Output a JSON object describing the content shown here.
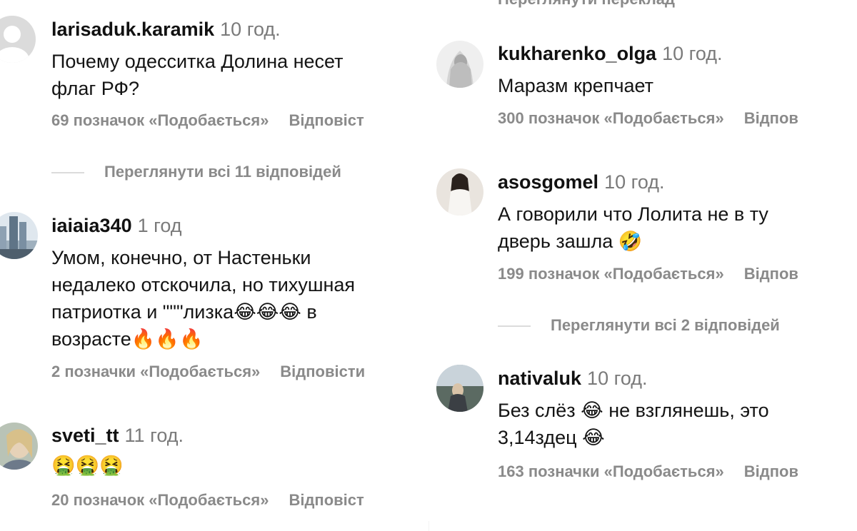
{
  "left": [
    {
      "username": "larisaduk.karamik",
      "time": "10 год.",
      "lines": [
        "Почему одесситка Долина несет",
        "флаг РФ?"
      ],
      "likes": "69 позначок «Подобається»",
      "reply": "Відповіст",
      "view_replies": "Переглянути всі 11 відповідей"
    },
    {
      "username": "iaiaia340",
      "time": "1 год",
      "lines": [
        "Умом, конечно, от Настеньки",
        "недалеко отскочила, но тихушная",
        "патриотка и \"\"\"лизка😂😂😂 в",
        "возрасте🔥🔥🔥"
      ],
      "likes": "2 позначки «Подобається»",
      "reply": "Відповісти"
    },
    {
      "username": "sveti_tt",
      "time": "11 год.",
      "lines": [
        "🤮🤮🤮"
      ],
      "likes": "20 позначок «Подобається»",
      "reply": "Відповіст"
    }
  ],
  "right": {
    "cut_text": "Переглянути переклад",
    "comments": [
      {
        "username": "kukharenko_olga",
        "time": "10 год.",
        "lines": [
          "Маразм крепчает"
        ],
        "likes": "300 позначок «Подобається»",
        "reply": "Відпов"
      },
      {
        "username": "asosgomel",
        "time": "10 год.",
        "lines": [
          "А говорили что Лолита не в ту",
          "дверь зашла 🤣"
        ],
        "likes": "199 позначок «Подобається»",
        "reply": "Відпов",
        "view_replies": "Переглянути всі 2 відповідей"
      },
      {
        "username": "nativaluk",
        "time": "10 год.",
        "lines": [
          "Без слёз 😂 не взглянешь, это",
          "3,14здец 😂"
        ],
        "likes": "163 позначки «Подобається»",
        "reply": "Відпов"
      }
    ]
  },
  "colors": {
    "username": "#111111",
    "meta": "#8a8a8a",
    "time": "#7a7a7a",
    "divider": "#dbdbdb"
  }
}
